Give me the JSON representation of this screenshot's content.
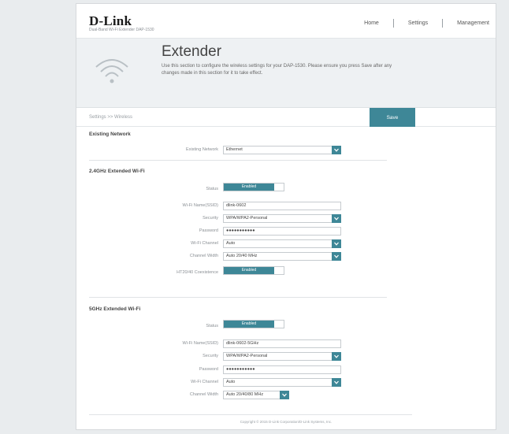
{
  "header": {
    "logo": "D-Link",
    "model_info": "Dual-Band Wi-Fi Extender DAP-1530",
    "nav": [
      "Home",
      "Settings",
      "Management"
    ]
  },
  "banner": {
    "title": "Extender",
    "description": "Use this section to configure the wireless settings for your DAP-1530. Please ensure you press Save after any changes made in this section for it to take effect.",
    "icon": "wifi-icon"
  },
  "breadcrumb": "Settings >> Wireless",
  "save_label": "Save",
  "existing": {
    "title": "Existing Network",
    "network_label": "Existing Network",
    "network_value": "Ethernet"
  },
  "ext24": {
    "title": "2.4GHz Extended Wi-Fi",
    "status_label": "Status",
    "status_value": "Enabled",
    "ssid_label": "Wi-Fi Name(SSID)",
    "ssid_value": "dlink-0602",
    "security_label": "Security",
    "security_value": "WPA/WPA2-Personal",
    "password_label": "Password",
    "password_value": "●●●●●●●●●●●",
    "channel_label": "Wi-Fi Channel",
    "channel_value": "Auto",
    "width_label": "Channel Width",
    "width_value": "Auto 20/40 MHz",
    "coexist_label": "HT20/40 Coexistence",
    "coexist_value": "Enabled"
  },
  "ext5": {
    "title": "5GHz Extended Wi-Fi",
    "status_label": "Status",
    "status_value": "Enabled",
    "ssid_label": "Wi-Fi Name(SSID)",
    "ssid_value": "dlink-0602-5GHz",
    "security_label": "Security",
    "security_value": "WPA/WPA2-Personal",
    "password_label": "Password",
    "password_value": "●●●●●●●●●●●",
    "channel_label": "Wi-Fi Channel",
    "channel_value": "Auto",
    "width_label": "Channel Width",
    "width_value": "Auto 20/40/80 MHz"
  },
  "footer": "Copyright © 2015 D-Link Corporation/D-Link Systems, Inc.",
  "colors": {
    "accent": "#3e8797"
  }
}
